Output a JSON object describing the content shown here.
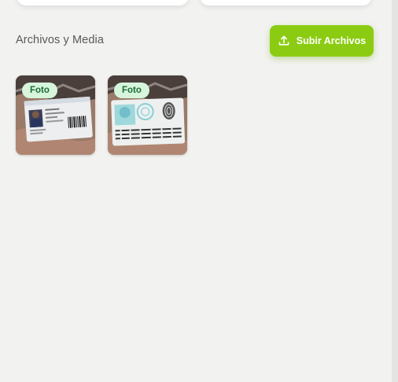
{
  "section": {
    "title": "Archivos y Media",
    "upload_label": "Subir Archivos"
  },
  "files": [
    {
      "badge": "Foto",
      "content": "ID card front photo"
    },
    {
      "badge": "Foto",
      "content": "ID card back photo"
    }
  ],
  "colors": {
    "accent": "#8bcc12",
    "badge_bg": "#d6f5dc",
    "badge_text": "#1c6b36"
  },
  "icons": {
    "upload": "upload-icon"
  }
}
